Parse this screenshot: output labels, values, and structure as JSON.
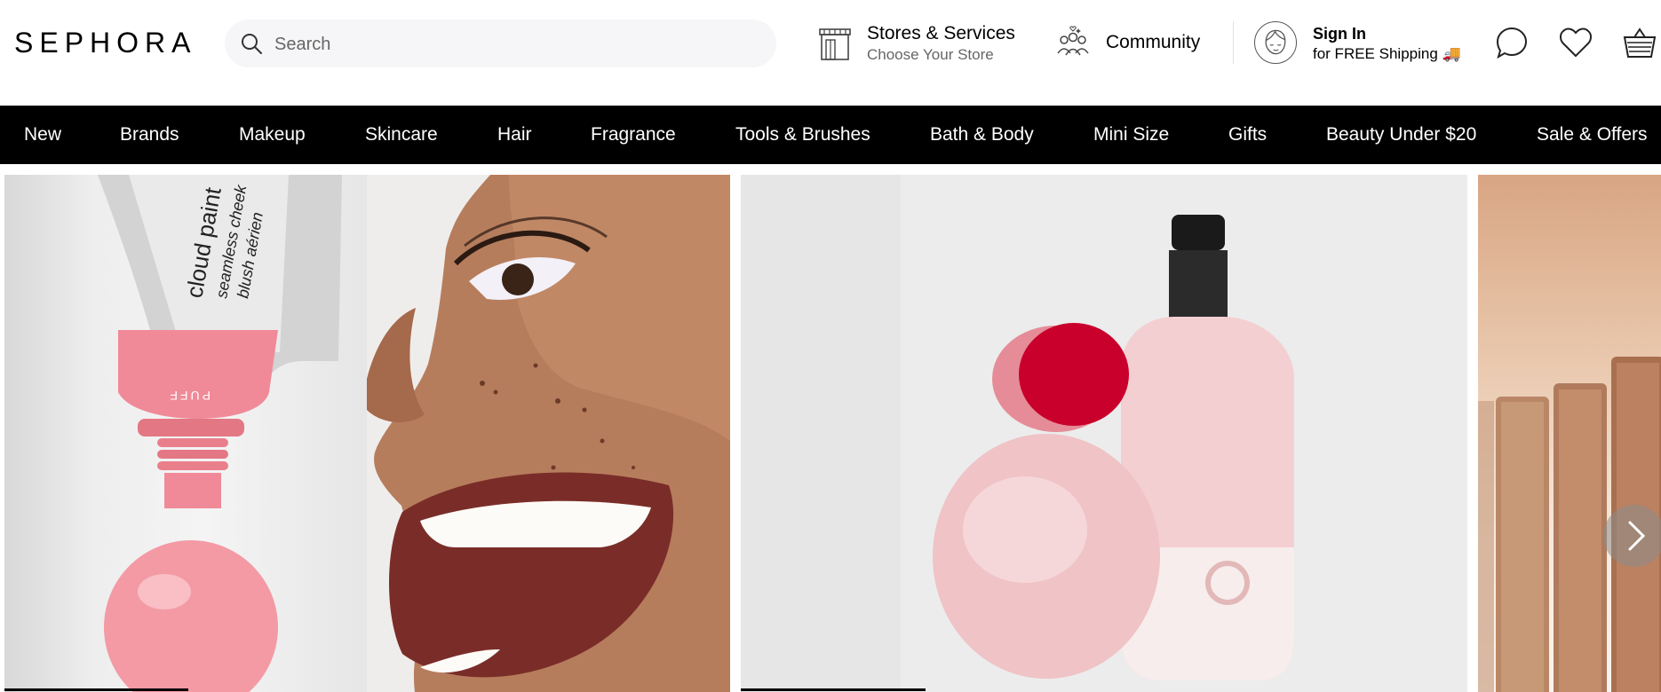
{
  "brand": {
    "logo_text": "SEPHORA"
  },
  "search": {
    "placeholder": "Search",
    "value": ""
  },
  "stores": {
    "title": "Stores & Services",
    "subtitle": "Choose Your Store",
    "icon": "store-icon"
  },
  "community": {
    "label": "Community",
    "icon": "community-icon"
  },
  "signin": {
    "title": "Sign In",
    "subtitle": "for FREE Shipping 🚚",
    "icon": "avatar-icon"
  },
  "header_icons": [
    "chat-icon",
    "heart-icon",
    "basket-icon"
  ],
  "nav": {
    "items": [
      "New",
      "Brands",
      "Makeup",
      "Skincare",
      "Hair",
      "Fragrance",
      "Tools & Brushes",
      "Bath & Body",
      "Mini Size",
      "Gifts",
      "Beauty Under $20",
      "Sale & Offers"
    ]
  },
  "hero": {
    "slides": [
      {
        "product_text": [
          "cloud paint",
          "seamless cheek",
          "blush aérien"
        ],
        "cap_text": "PUFF"
      },
      {
        "product_text": []
      }
    ],
    "next_icon": "chevron-right-icon"
  },
  "colors": {
    "nav_bg": "#000000",
    "search_bg": "#f6f6f8",
    "accent_pink": "#f08a98",
    "accent_red": "#c9002b"
  }
}
